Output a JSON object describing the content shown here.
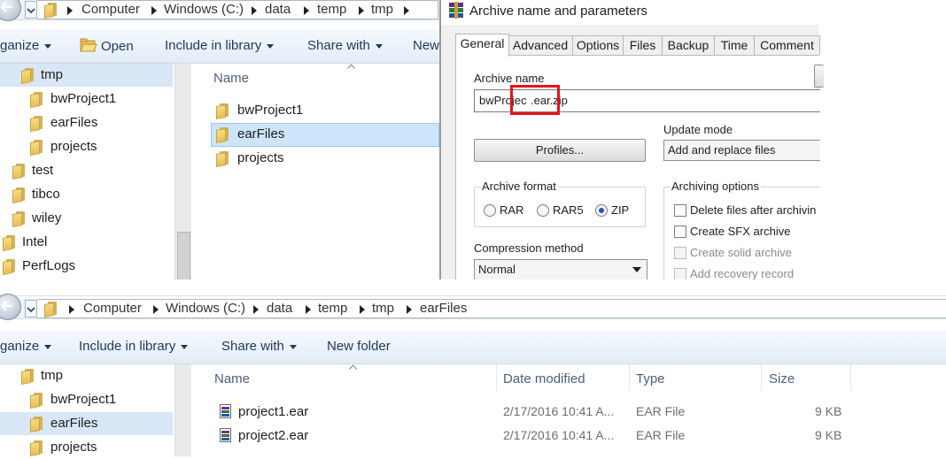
{
  "top_explorer": {
    "breadcrumb": [
      "Computer",
      "Windows (C:)",
      "data",
      "temp",
      "tmp"
    ],
    "toolbar": {
      "organize_label": "ganize",
      "open_label": "Open",
      "include_label": "Include in library",
      "share_label": "Share with",
      "new_label": "New"
    },
    "nav_items": [
      {
        "label": "tmp",
        "selected": true
      },
      {
        "label": "bwProject1"
      },
      {
        "label": "earFiles"
      },
      {
        "label": "projects"
      },
      {
        "label": "test"
      },
      {
        "label": "tibco"
      },
      {
        "label": "wiley"
      },
      {
        "label": "Intel"
      },
      {
        "label": "PerfLogs"
      }
    ],
    "column_name": "Name",
    "files": [
      {
        "label": "bwProject1"
      },
      {
        "label": "earFiles",
        "selected": true
      },
      {
        "label": "projects"
      }
    ]
  },
  "winrar": {
    "title": "Archive name and parameters",
    "tabs": [
      "General",
      "Advanced",
      "Options",
      "Files",
      "Backup",
      "Time",
      "Comment"
    ],
    "active_tab": "General",
    "archive_name_label": "Archive name",
    "archive_name_prefix": "bwProjec",
    "archive_name_highlighted": ".ear.zip",
    "profiles_label": "Profiles...",
    "update_mode_label": "Update mode",
    "update_mode_value": "Add and replace files",
    "archive_format_label": "Archive format",
    "formats": [
      {
        "label": "RAR",
        "selected": false
      },
      {
        "label": "RAR5",
        "selected": false
      },
      {
        "label": "ZIP",
        "selected": true
      }
    ],
    "compression_label": "Compression method",
    "compression_value": "Normal",
    "archiving_options_label": "Archiving options",
    "options": [
      {
        "label": "Delete files after archivin",
        "disabled": false
      },
      {
        "label": "Create SFX archive",
        "disabled": false
      },
      {
        "label": "Create solid archive",
        "disabled": true
      },
      {
        "label": "Add recovery record",
        "disabled": true
      }
    ],
    "colors": {
      "highlight_box": "#e3141c"
    }
  },
  "bottom_explorer": {
    "breadcrumb": [
      "Computer",
      "Windows (C:)",
      "data",
      "temp",
      "tmp",
      "earFiles"
    ],
    "toolbar": {
      "organize_label": "ganize",
      "include_label": "Include in library",
      "share_label": "Share with",
      "new_folder_label": "New folder"
    },
    "nav_items": [
      {
        "label": "tmp"
      },
      {
        "label": "bwProject1"
      },
      {
        "label": "earFiles",
        "selected": true
      },
      {
        "label": "projects"
      }
    ],
    "columns": {
      "name": "Name",
      "date": "Date modified",
      "type": "Type",
      "size": "Size"
    },
    "files": [
      {
        "name": "project1.ear",
        "date": "2/17/2016 10:41 A...",
        "type": "EAR File",
        "size": "9 KB"
      },
      {
        "name": "project2.ear",
        "date": "2/17/2016 10:41 A...",
        "type": "EAR File",
        "size": "9 KB"
      }
    ]
  }
}
